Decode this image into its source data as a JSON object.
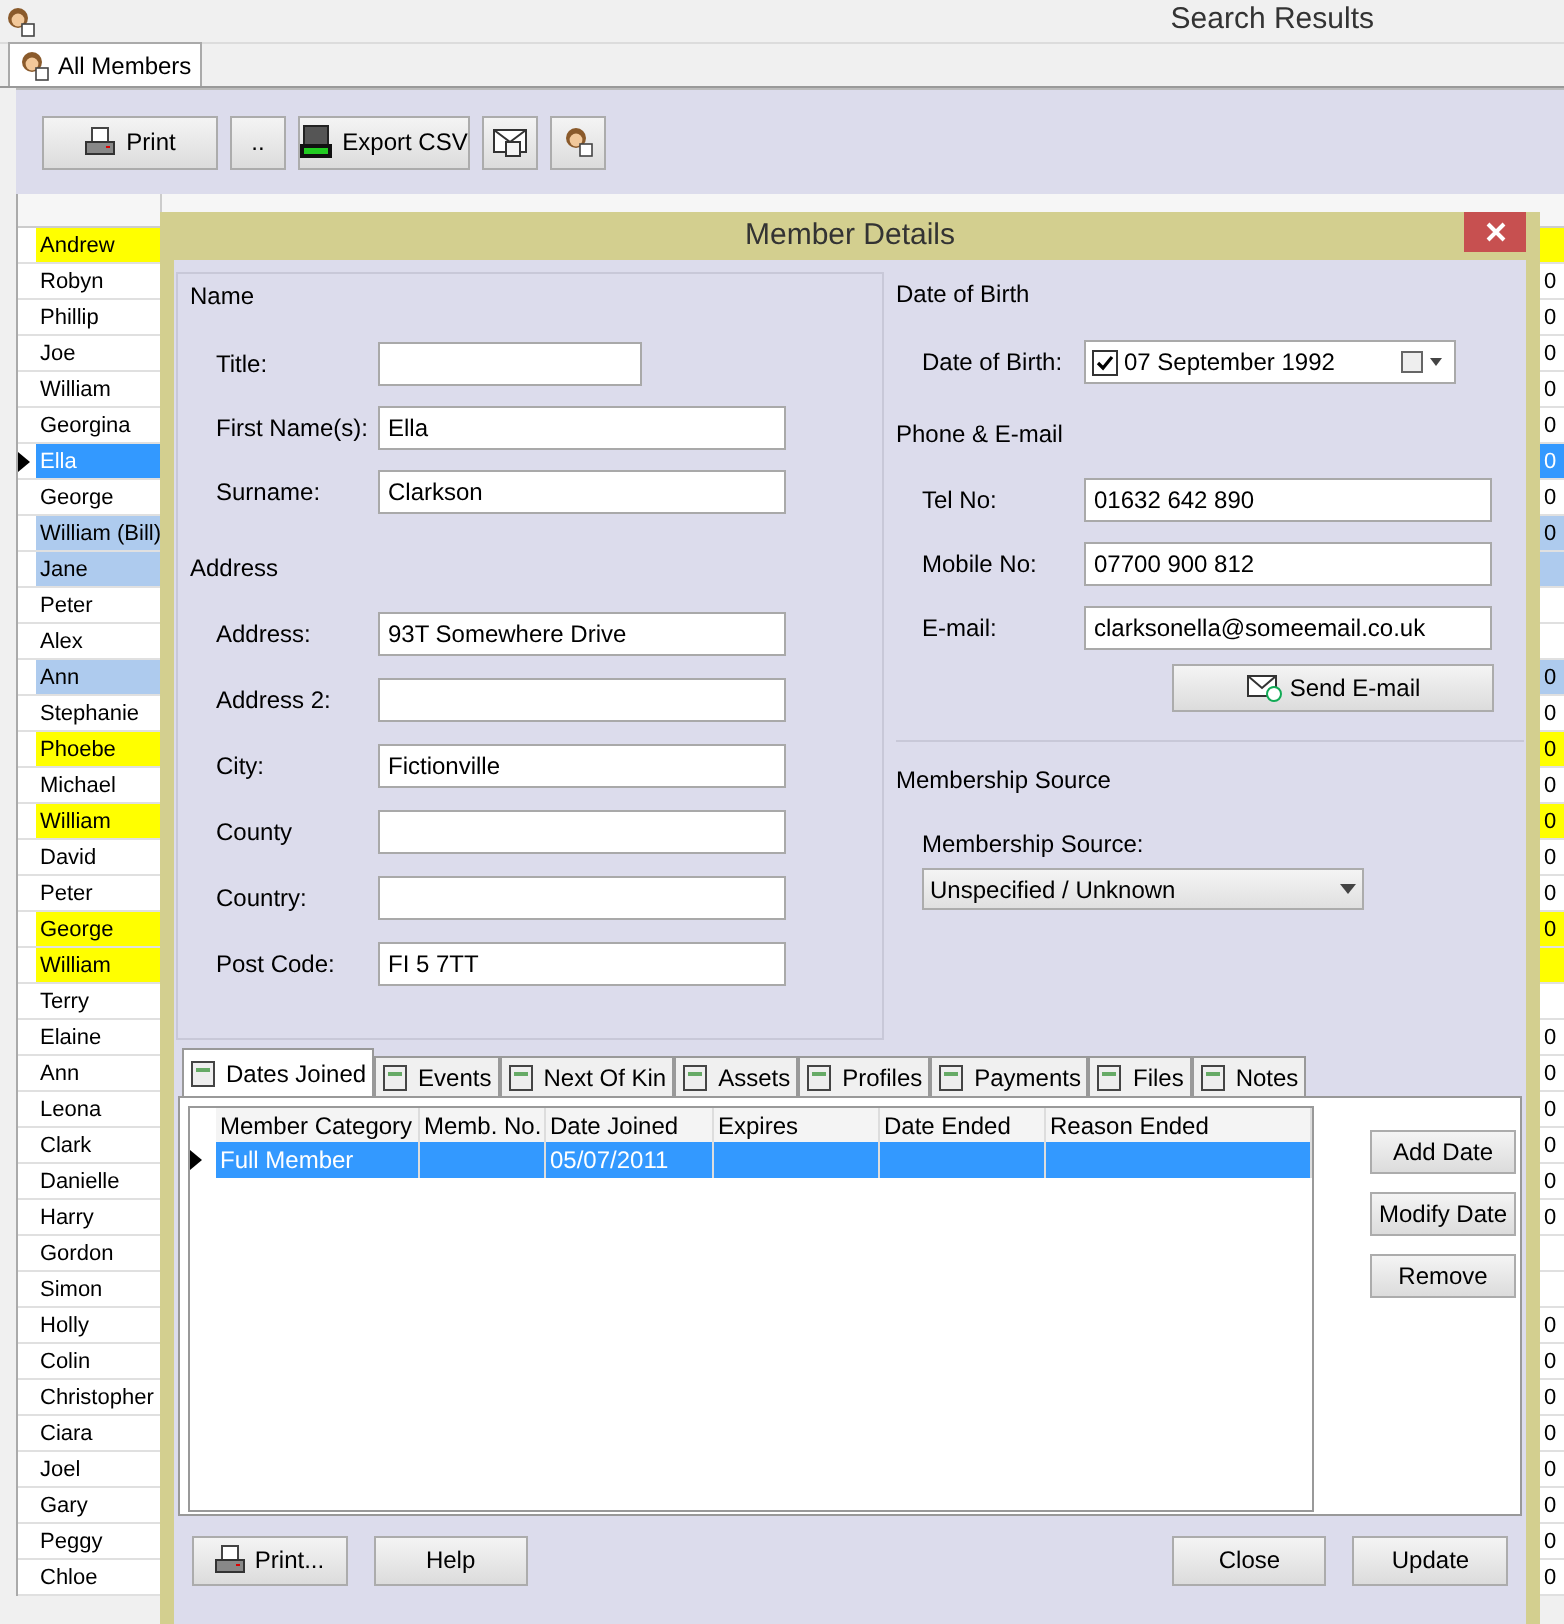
{
  "window": {
    "title": "Search Results"
  },
  "tabs": [
    {
      "label": "All Members",
      "selected": true
    }
  ],
  "toolbar": {
    "buttons": [
      {
        "kind": "print",
        "label": "Print"
      },
      {
        "kind": "more",
        "label": ".."
      },
      {
        "kind": "csv",
        "label": "Export CSV"
      },
      {
        "kind": "mail"
      },
      {
        "kind": "member"
      }
    ]
  },
  "table": {
    "rows": [
      {
        "first_name": "Andrew",
        "color": "#ffff00",
        "selected": false
      },
      {
        "first_name": "Robyn",
        "selected": false,
        "mobile": "0"
      },
      {
        "first_name": "Phillip",
        "selected": false,
        "mobile": "0"
      },
      {
        "first_name": "Joe",
        "selected": false,
        "mobile": "0"
      },
      {
        "first_name": "William",
        "selected": false,
        "mobile": "0"
      },
      {
        "first_name": "Georgina",
        "selected": false,
        "mobile": "0"
      },
      {
        "first_name": "Ella",
        "selected": true,
        "mobile": "0"
      },
      {
        "first_name": "George",
        "selected": false,
        "mobile": "0"
      },
      {
        "first_name": "William (Bill)",
        "color": "#aecbee",
        "selected": false,
        "mobile": "0"
      },
      {
        "first_name": "Jane",
        "color": "#aecbee",
        "selected": false
      },
      {
        "first_name": "Peter",
        "selected": false
      },
      {
        "first_name": "Alex",
        "selected": false
      },
      {
        "first_name": "Ann",
        "color": "#aecbee",
        "selected": false,
        "mobile": "0"
      },
      {
        "first_name": "Stephanie",
        "selected": false,
        "mobile": "0"
      },
      {
        "first_name": "Phoebe",
        "color": "#ffff00",
        "selected": false,
        "mobile": "0"
      },
      {
        "first_name": "Michael",
        "selected": false,
        "mobile": "0"
      },
      {
        "first_name": "William",
        "color": "#ffff00",
        "selected": false,
        "mobile": "0"
      },
      {
        "first_name": "David",
        "selected": false,
        "mobile": "0"
      },
      {
        "first_name": "Peter",
        "selected": false,
        "mobile": "0"
      },
      {
        "first_name": "George",
        "color": "#ffff00",
        "selected": false,
        "mobile": "0"
      },
      {
        "first_name": "William",
        "color": "#ffff00",
        "selected": false
      },
      {
        "first_name": "Terry",
        "selected": false
      },
      {
        "first_name": "Elaine",
        "selected": false,
        "mobile": "0"
      },
      {
        "first_name": "Ann",
        "selected": false,
        "mobile": "0"
      },
      {
        "first_name": "Leona",
        "selected": false,
        "mobile": "0"
      },
      {
        "first_name": "Clark",
        "selected": false,
        "mobile": "0"
      },
      {
        "first_name": "Danielle",
        "selected": false,
        "mobile": "0"
      },
      {
        "first_name": "Harry",
        "selected": false,
        "mobile": "0"
      },
      {
        "first_name": "Gordon",
        "selected": false
      },
      {
        "first_name": "Simon",
        "selected": false
      },
      {
        "first_name": "Holly",
        "selected": false,
        "mobile": "0"
      },
      {
        "first_name": "Colin",
        "selected": false,
        "mobile": "0"
      },
      {
        "first_name": "Christopher",
        "selected": false,
        "mobile": "0"
      },
      {
        "first_name": "Ciara",
        "selected": false,
        "mobile": "0"
      },
      {
        "first_name": "Joel",
        "selected": false,
        "mobile": "0"
      },
      {
        "first_name": "Gary",
        "selected": false,
        "mobile": "0"
      },
      {
        "first_name": "Peggy",
        "selected": false,
        "mobile": "0"
      },
      {
        "first_name": "Chloe",
        "selected": false,
        "mobile": "0"
      }
    ]
  },
  "dialog": {
    "title": "Member Details",
    "name_section": {
      "heading": "Name",
      "fields": [
        {
          "label": "Title:",
          "kind": "short"
        },
        {
          "label": "First Name(s):",
          "value": "Ella"
        },
        {
          "label": "Surname:",
          "value": "Clarkson"
        }
      ]
    },
    "address_section": {
      "heading": "Address",
      "fields": [
        {
          "label": "Address:",
          "value": "93T Somewhere Drive"
        },
        {
          "label": "Address 2:"
        },
        {
          "label": "City:",
          "value": "Fictionville"
        },
        {
          "label": "County"
        },
        {
          "label": "Country:"
        },
        {
          "label": "Post Code:",
          "value": "FI 5 7TT"
        }
      ]
    },
    "dob_section": {
      "heading": "Date of Birth",
      "label": "Date of Birth:",
      "checked": true,
      "value": "07 September 1992"
    },
    "contact_section": {
      "heading": "Phone & E-mail",
      "fields": [
        {
          "label": "Tel No:",
          "value": "01632 642 890"
        },
        {
          "label": "Mobile No:",
          "value": "07700 900 812"
        },
        {
          "label": "E-mail:",
          "value": "clarksonella@someemail.co.uk"
        }
      ],
      "send_button": "Send E-mail"
    },
    "source_section": {
      "heading": "Membership Source",
      "label": "Membership Source:",
      "value": "Unspecified / Unknown"
    },
    "tabs": [
      {
        "label": "Dates Joined",
        "selected": true
      },
      {
        "label": "Events",
        "selected": false
      },
      {
        "label": "Next Of Kin",
        "selected": false
      },
      {
        "label": "Assets",
        "selected": false
      },
      {
        "label": "Profiles",
        "selected": false
      },
      {
        "label": "Payments",
        "selected": false
      },
      {
        "label": "Files",
        "selected": false
      },
      {
        "label": "Notes",
        "selected": false
      }
    ],
    "grid": {
      "columns": [
        "Member Category",
        "Memb. No.",
        "Date Joined",
        "Expires",
        "Date Ended",
        "Reason Ended"
      ],
      "rows": [
        {
          "selected": true,
          "cells": [
            "Full Member",
            "",
            "05/07/2011",
            "",
            "",
            ""
          ]
        }
      ]
    },
    "side_buttons": [
      "Add Date",
      "Modify Date",
      "Remove"
    ],
    "footer_buttons": [
      {
        "label": "Print...",
        "kind": "print"
      },
      {
        "label": "Help",
        "kind": "plain"
      },
      {
        "label": "Close",
        "kind": "plain"
      },
      {
        "label": "Update",
        "kind": "plain"
      }
    ]
  }
}
